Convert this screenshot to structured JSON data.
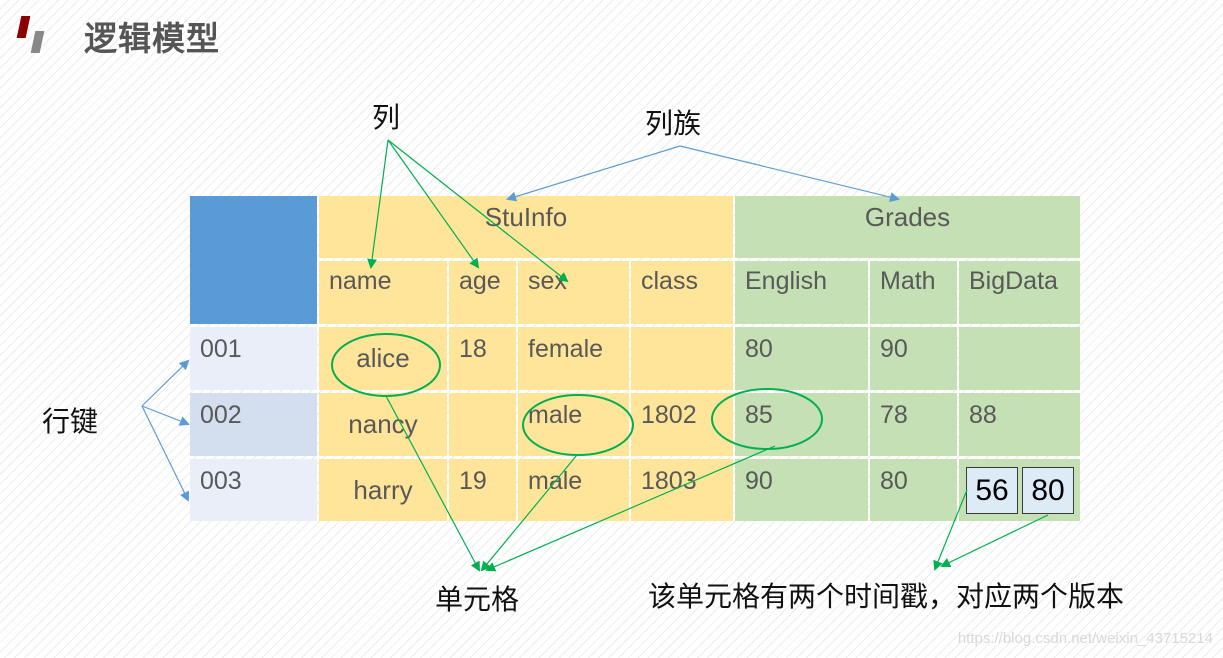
{
  "title": "逻辑模型",
  "colors": {
    "logo_primary": "#8b0000",
    "logo_secondary": "#888888",
    "column_family_stuinfo": "#fee599",
    "column_family_grades": "#c5e0b4",
    "row_key": "#e9eef8",
    "corner": "#5b9bd5",
    "annotation_green": "#00b050",
    "annotation_blue": "#5b9bd5"
  },
  "labels": {
    "column": "列",
    "column_family": "列族",
    "row_key": "行键",
    "cell": "单元格",
    "versions_note": "该单元格有两个时间戳，对应两个版本"
  },
  "table": {
    "column_families": [
      {
        "name": "StuInfo",
        "columns": [
          "name",
          "age",
          "sex",
          "class"
        ]
      },
      {
        "name": "Grades",
        "columns": [
          "English",
          "Math",
          "BigData"
        ]
      }
    ],
    "rows": [
      {
        "key": "001",
        "cells": [
          "alice",
          "18",
          "female",
          "",
          "80",
          "90",
          ""
        ]
      },
      {
        "key": "002",
        "cells": [
          "nancy",
          "",
          "male",
          "1802",
          "85",
          "78",
          "88"
        ]
      },
      {
        "key": "003",
        "cells": [
          "harry",
          "19",
          "male",
          "1803",
          "90",
          "80",
          ""
        ]
      }
    ],
    "bigdata_versions": [
      "56",
      "80"
    ]
  },
  "watermark": "https://blog.csdn.net/weixin_43715214"
}
